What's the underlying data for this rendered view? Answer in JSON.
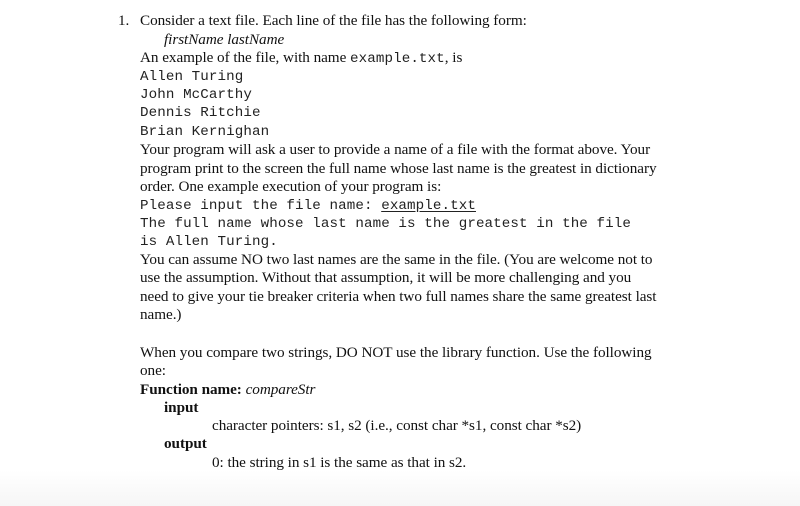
{
  "problem": {
    "number": "1.",
    "intro": "Consider a text file. Each line of the file has the following form:",
    "format": "firstName lastName",
    "example_prefix": "An example of the file, with name ",
    "example_filename": "example.txt",
    "example_suffix": ", is",
    "file_lines": [
      "Allen Turing",
      "John McCarthy",
      "Dennis Ritchie",
      "Brian Kernighan"
    ],
    "description_lines": [
      "Your program will ask a user to provide a name of a file with the format above. Your",
      "program print to the screen the full name whose last name is the greatest in dictionary",
      "order. One example execution of your program is:"
    ],
    "execution": {
      "prompt": "Please input the file name: ",
      "user_input": "example.txt",
      "output_lines": [
        "The full name whose last name is the greatest in the file",
        "is Allen Turing."
      ]
    },
    "assumption_lines": [
      "You can assume NO two last names are the same in the file. (You are welcome not to",
      "use the assumption. Without that assumption, it will be more challenging and you",
      "need to give your tie breaker criteria when two full names share the same greatest last",
      "name.)"
    ],
    "compare_lines": [
      "When you compare two strings, DO NOT use the library function. Use the following",
      "one:"
    ],
    "function": {
      "name_label": "Function name: ",
      "name_value": "compareStr",
      "input_label": "input",
      "input_desc": "character pointers: s1, s2 (i.e., const char *s1, const char *s2)",
      "output_label": "output",
      "output_desc": "0: the string in s1 is the same as that in s2."
    }
  }
}
